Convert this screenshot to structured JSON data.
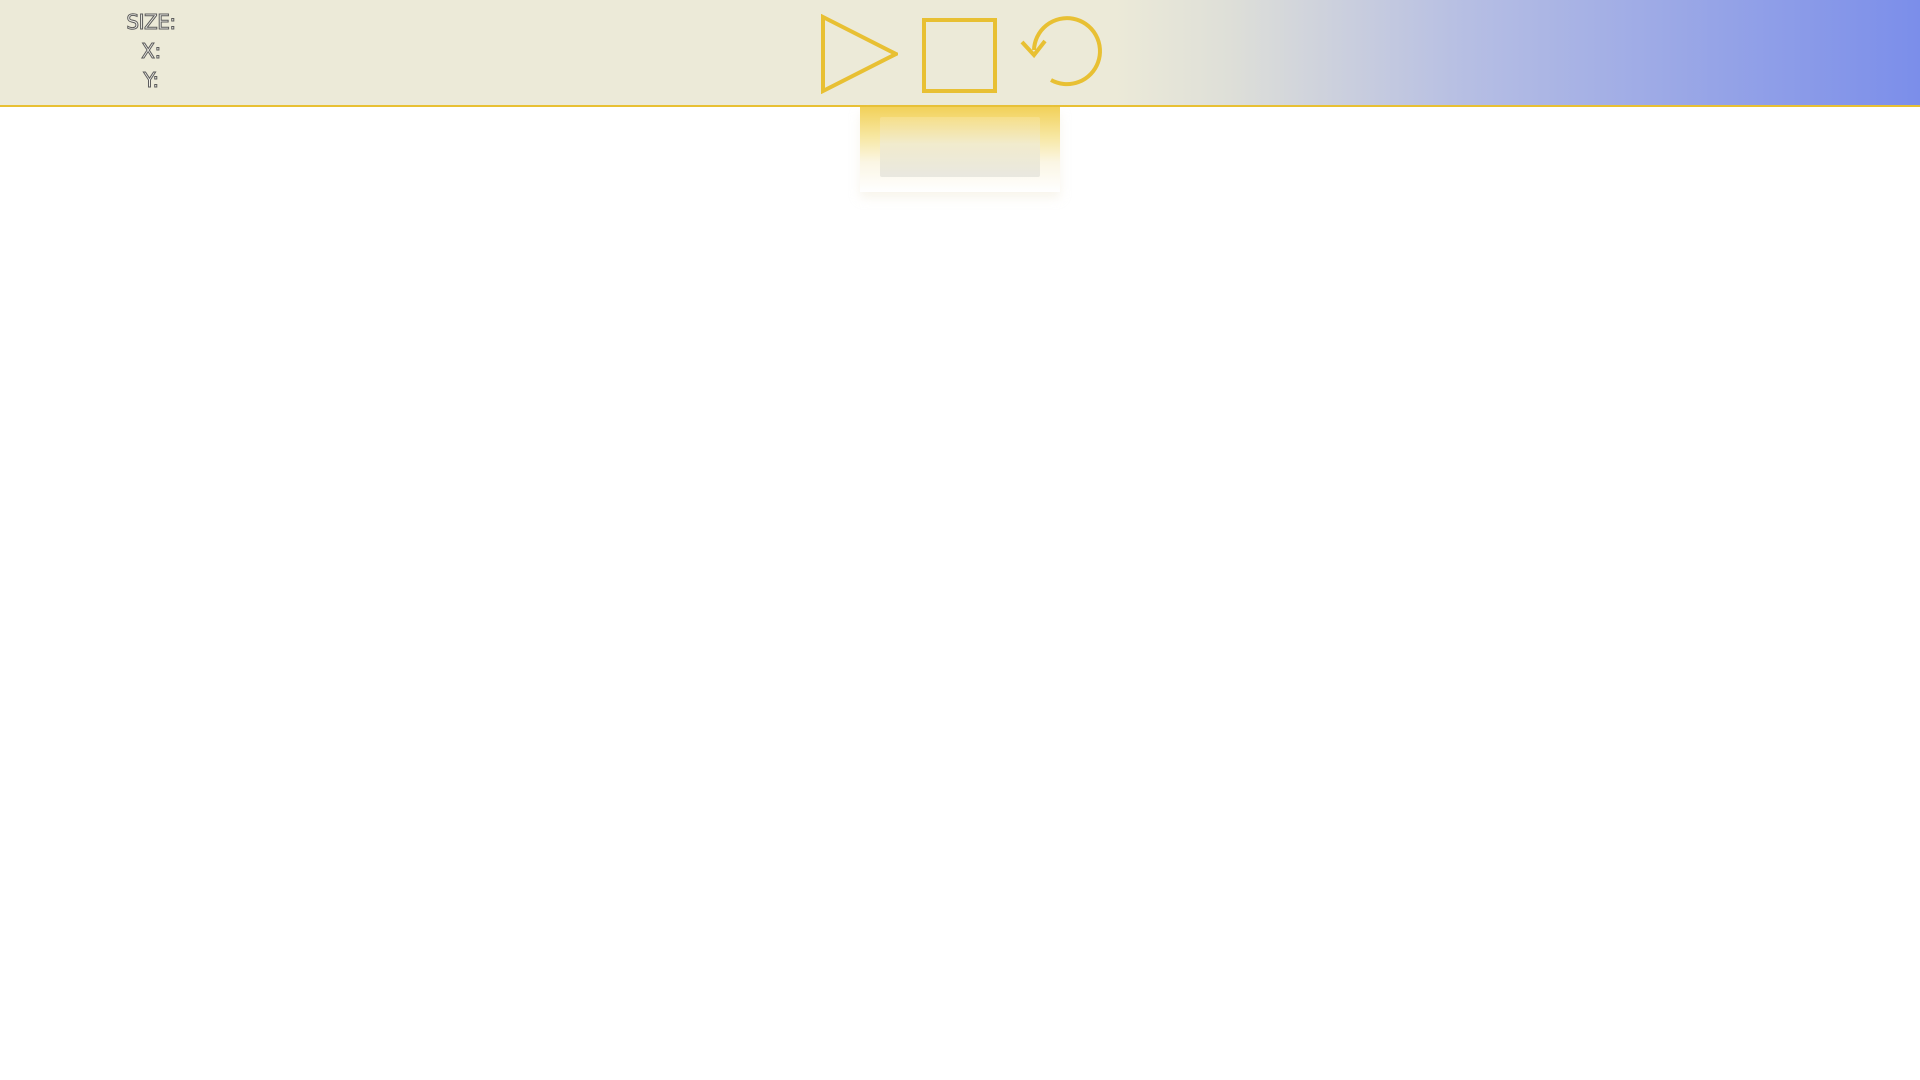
{
  "toolbar": {
    "readout": {
      "size_label": "SIZE:",
      "x_label": "X:",
      "y_label": "Y:"
    },
    "controls": {
      "play_icon": "play-icon",
      "stop_icon": "stop-icon",
      "reset_icon": "reset-icon"
    }
  },
  "colors": {
    "accent": "#e8c033",
    "toolbar_bg": "#ecead8",
    "gradient_end": "#7b8eea",
    "canvas_bg": "#ffffff"
  }
}
